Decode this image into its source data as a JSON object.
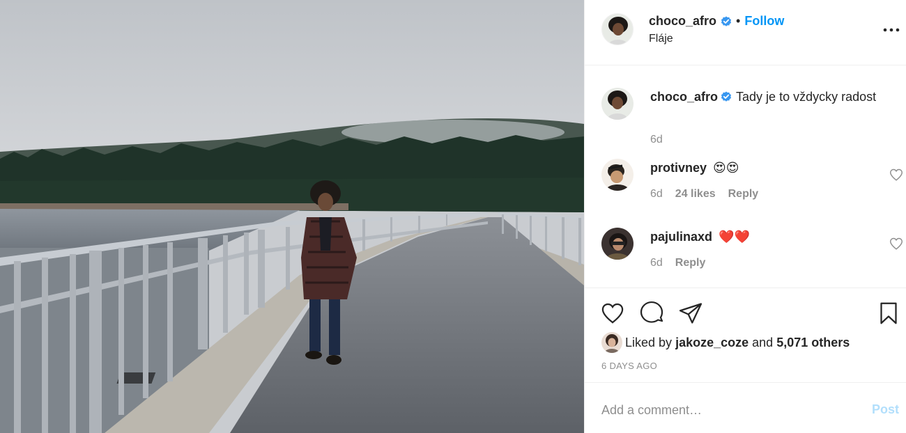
{
  "post": {
    "author": {
      "username": "choco_afro",
      "verified": true,
      "location": "Fláje",
      "follow_label": "Follow",
      "separator": "•"
    },
    "caption": {
      "username": "choco_afro",
      "text": "Tady je to vždycky radost",
      "age": "6d"
    },
    "comments": [
      {
        "username": "protivney",
        "text": "😍😍",
        "age": "6d",
        "likes": "24 likes",
        "reply_label": "Reply"
      },
      {
        "username": "pajulinaxd",
        "text": "❤️❤️",
        "age": "6d",
        "reply_label": "Reply"
      }
    ],
    "likes": {
      "prefix": "Liked by",
      "user": "jakoze_coze",
      "joiner": "and",
      "others": "5,071 others"
    },
    "timestamp": "6 DAYS AGO"
  },
  "add_comment": {
    "placeholder": "Add a comment…",
    "post_label": "Post"
  },
  "icons": {
    "more": "more-options-icon",
    "verified": "verified-badge-icon",
    "like": "heart-icon",
    "comment": "comment-bubble-icon",
    "share": "paper-plane-icon",
    "save": "bookmark-icon"
  },
  "colors": {
    "link_blue": "#0095f6",
    "post_disabled": "#b2dffc",
    "muted": "#8e8e8e",
    "text": "#262626",
    "divider": "#efefef",
    "verified_blue": "#3897f0"
  }
}
